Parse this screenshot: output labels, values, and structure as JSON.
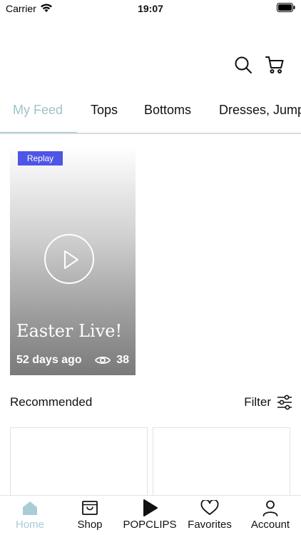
{
  "status_bar": {
    "carrier": "Carrier",
    "time": "19:07"
  },
  "tabs": [
    {
      "label": "My Feed",
      "active": true
    },
    {
      "label": "Tops"
    },
    {
      "label": "Bottoms"
    },
    {
      "label": "Dresses, Jump"
    }
  ],
  "feed_card": {
    "badge": "Replay",
    "title": "Easter Live!",
    "posted": "52 days ago",
    "views": "38"
  },
  "recommended": {
    "title": "Recommended",
    "filter_label": "Filter"
  },
  "tab_bar": [
    {
      "label": "Home",
      "icon": "home-icon",
      "active": true
    },
    {
      "label": "Shop",
      "icon": "shop-icon"
    },
    {
      "label": "POPCLIPS",
      "icon": "play-icon"
    },
    {
      "label": "Favorites",
      "icon": "heart-icon"
    },
    {
      "label": "Account",
      "icon": "account-icon"
    }
  ],
  "colors": {
    "accent": "#9dc3cc",
    "badge": "#4f55e6",
    "home_active": "#a8cdd6"
  }
}
